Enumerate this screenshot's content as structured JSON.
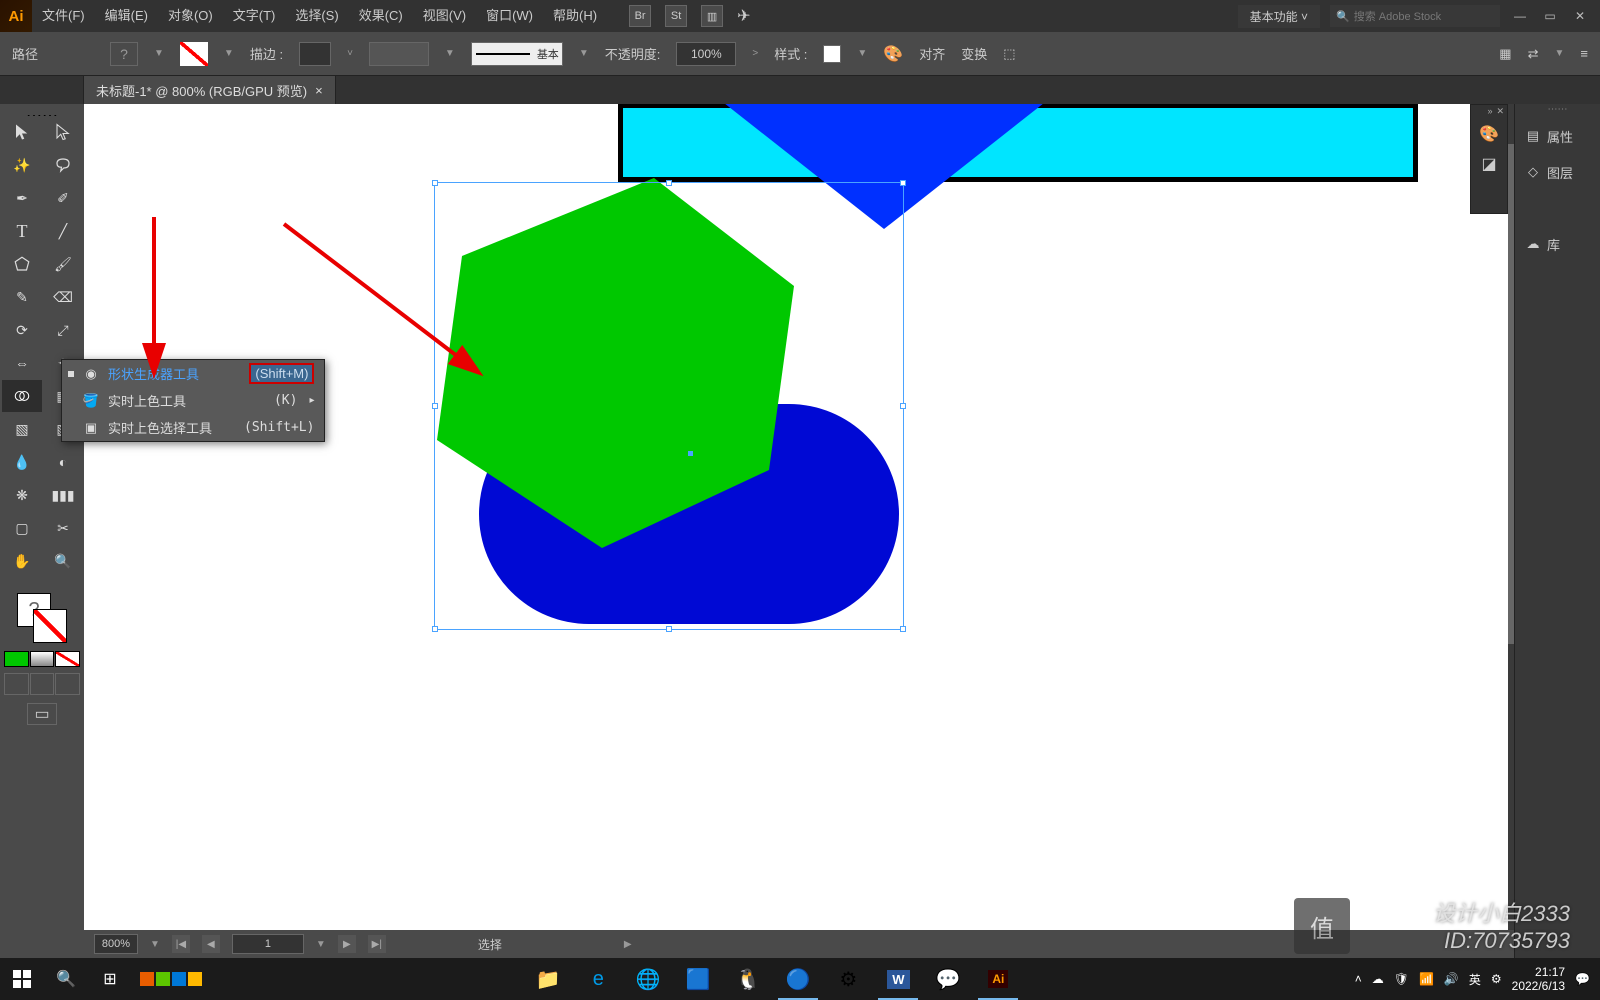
{
  "menu": {
    "items": [
      "文件(F)",
      "编辑(E)",
      "对象(O)",
      "文字(T)",
      "选择(S)",
      "效果(C)",
      "视图(V)",
      "窗口(W)",
      "帮助(H)"
    ]
  },
  "workspace_selector": "基本功能",
  "search_placeholder": "搜索 Adobe Stock",
  "control": {
    "label_path": "路径",
    "stroke_label": "描边 :",
    "stroke_style_label": "基本",
    "opacity_label": "不透明度:",
    "opacity_value": "100%",
    "style_label": "样式 :",
    "align_label": "对齐",
    "transform_label": "变换"
  },
  "doc_tab": {
    "title": "未标题-1* @ 800% (RGB/GPU 预览)",
    "close": "×"
  },
  "flyout": {
    "items": [
      {
        "label": "形状生成器工具",
        "shortcut": "(Shift+M)",
        "selected": true
      },
      {
        "label": "实时上色工具",
        "shortcut": "(K)",
        "selected": false,
        "has_sub": true
      },
      {
        "label": "实时上色选择工具",
        "shortcut": "(Shift+L)",
        "selected": false
      }
    ]
  },
  "right_panels": [
    "属性",
    "图层",
    "库"
  ],
  "status": {
    "zoom": "800%",
    "artboard": "1",
    "mode": "选择"
  },
  "taskbar": {
    "time": "21:17",
    "date": "2022/6/13",
    "ime": "英"
  },
  "watermark": {
    "name": "设计小白2333",
    "id": "ID:70735793"
  },
  "colors": {
    "accent": "#ff9a00",
    "shape_green": "#00c800",
    "shape_blue": "#0009d4",
    "shape_cyan": "#00e5ff",
    "annotation": "#e80000"
  }
}
